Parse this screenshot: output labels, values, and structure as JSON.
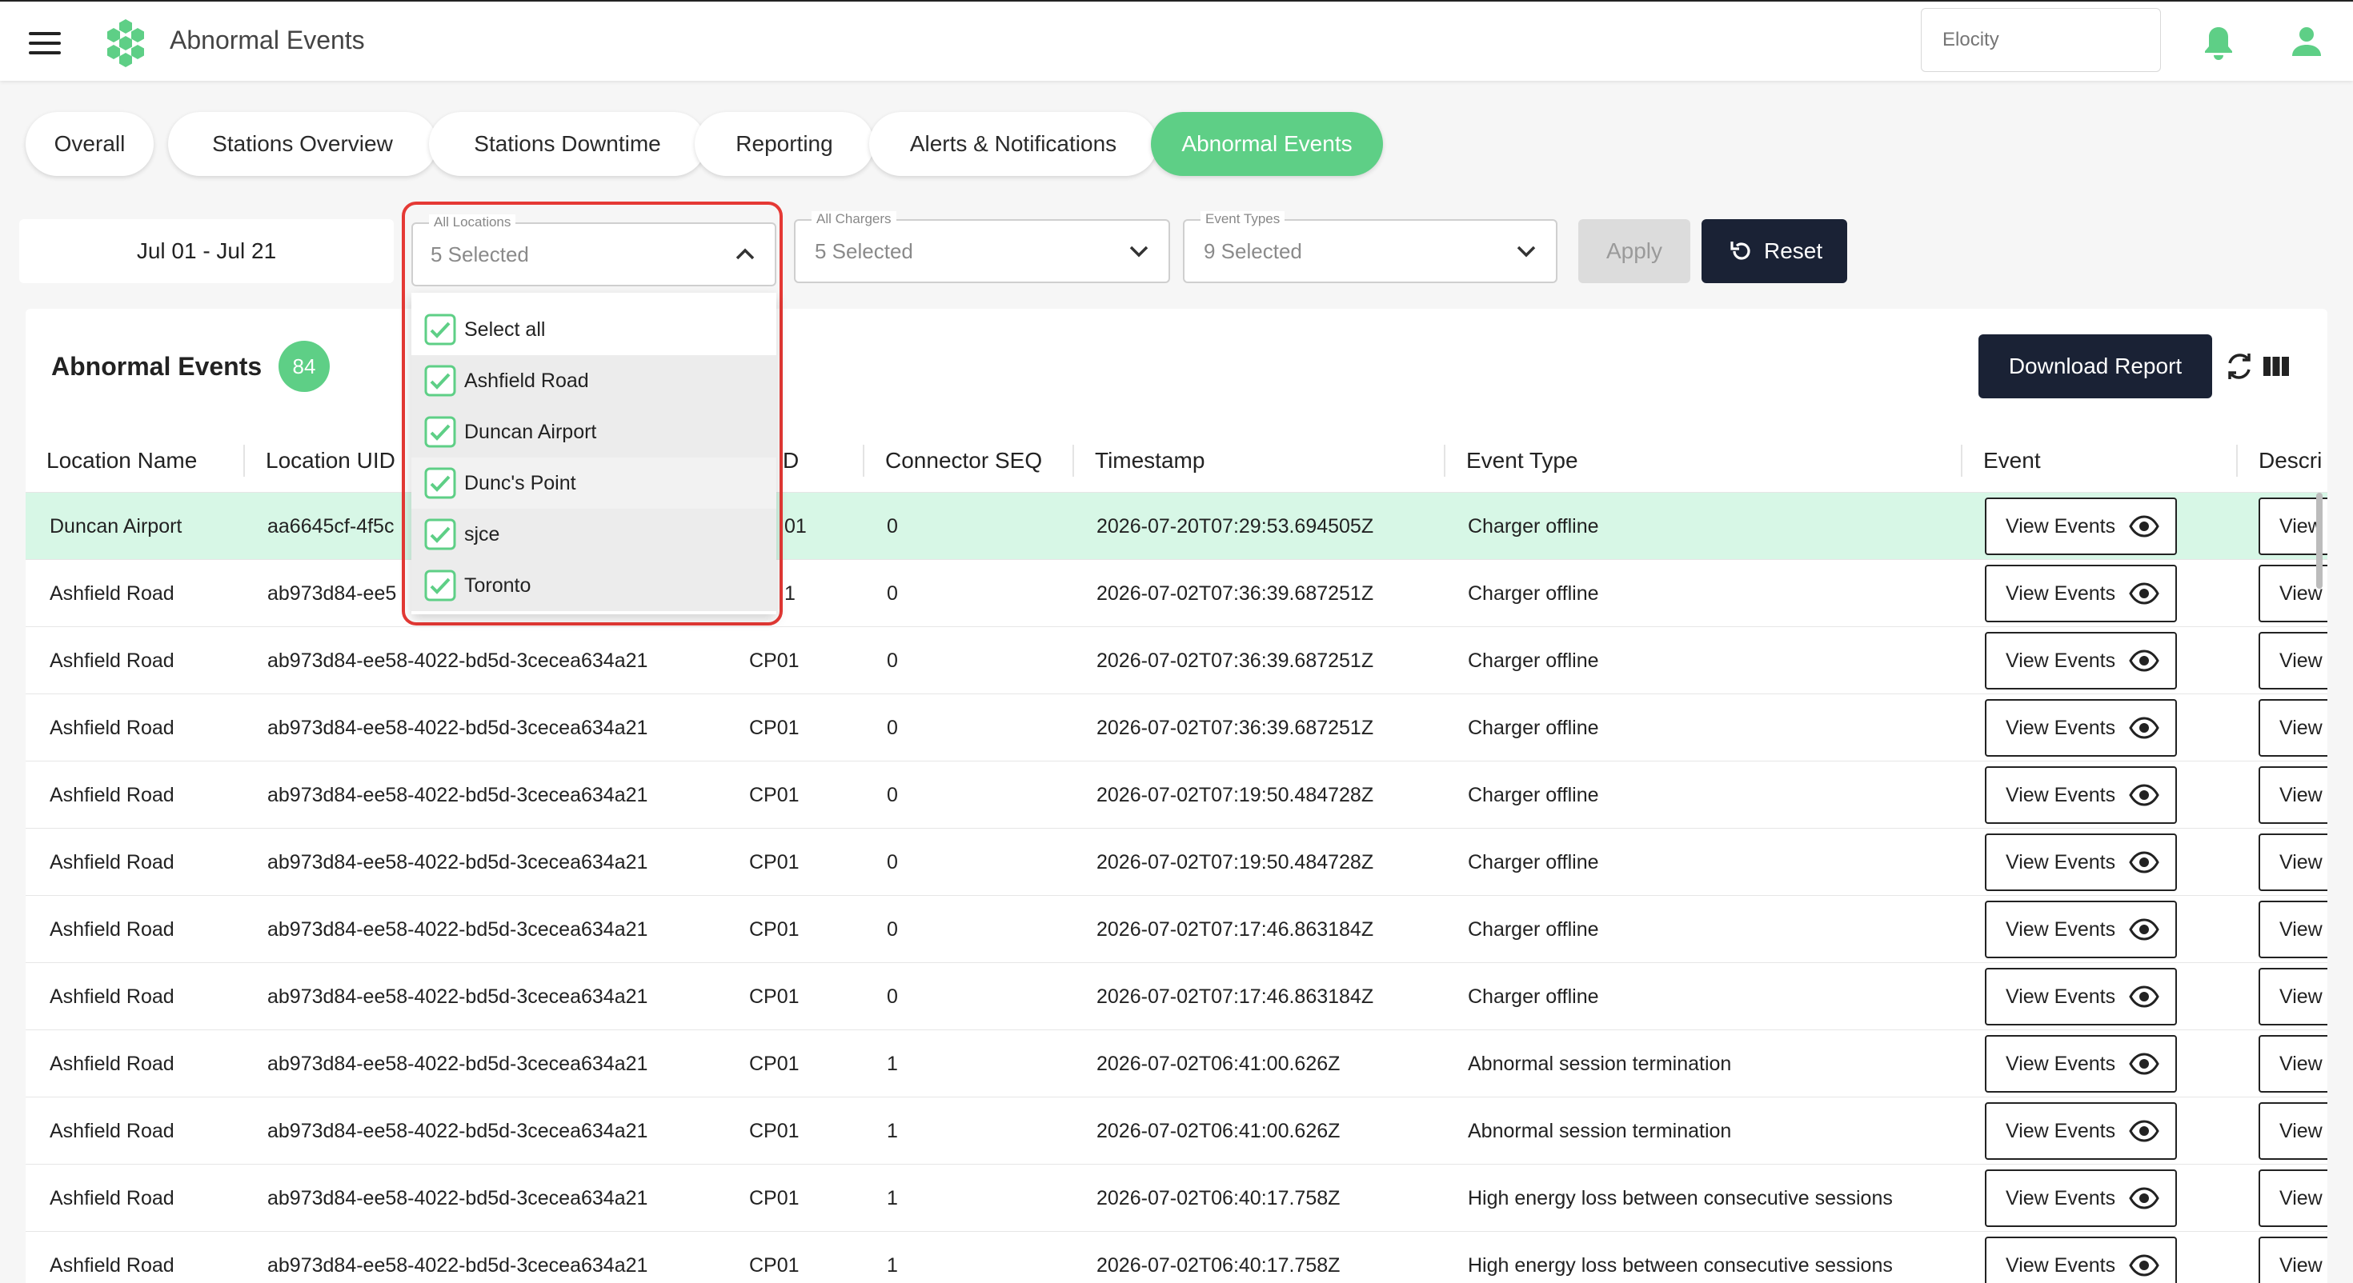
{
  "app": {
    "title": "Abnormal Events",
    "org_placeholder": "Elocity",
    "accent": "#5ecf86",
    "dark": "#1a2235"
  },
  "tabs": [
    {
      "label": "Overall",
      "active": false
    },
    {
      "label": "Stations Overview",
      "active": false
    },
    {
      "label": "Stations Downtime",
      "active": false
    },
    {
      "label": "Reporting",
      "active": false
    },
    {
      "label": "Alerts & Notifications",
      "active": false
    },
    {
      "label": "Abnormal Events",
      "active": true
    }
  ],
  "filters": {
    "date_range": "Jul 01 - Jul 21",
    "locations": {
      "label": "All Locations",
      "value": "5 Selected"
    },
    "chargers": {
      "label": "All Chargers",
      "value": "5 Selected"
    },
    "event_types": {
      "label": "Event Types",
      "value": "9 Selected"
    },
    "apply_label": "Apply",
    "reset_label": "Reset"
  },
  "location_dropdown": {
    "options": [
      {
        "label": "Select all",
        "checked": true
      },
      {
        "label": "Ashfield Road",
        "checked": true
      },
      {
        "label": "Duncan Airport",
        "checked": true
      },
      {
        "label": "Dunc's Point",
        "checked": true
      },
      {
        "label": "sjce",
        "checked": true
      },
      {
        "label": "Toronto",
        "checked": true
      }
    ]
  },
  "card": {
    "title": "Abnormal Events",
    "count": "84",
    "download_label": "Download Report"
  },
  "table": {
    "headers": [
      "Location Name",
      "Location UID",
      "D",
      "Connector SEQ",
      "Timestamp",
      "Event Type",
      "Event",
      "Descri"
    ],
    "view_label": "View Events",
    "view2_label": "View",
    "rows": [
      {
        "location": "Duncan Airport",
        "uid": "aa6645cf-4f5c",
        "charger": "01",
        "seq": "0",
        "ts": "2026-07-20T07:29:53.694505Z",
        "type": "Charger offline"
      },
      {
        "location": "Ashfield Road",
        "uid": "ab973d84-ee5",
        "charger": "1",
        "seq": "0",
        "ts": "2026-07-02T07:36:39.687251Z",
        "type": "Charger offline"
      },
      {
        "location": "Ashfield Road",
        "uid": "ab973d84-ee58-4022-bd5d-3cecea634a21",
        "charger": "CP01",
        "seq": "0",
        "ts": "2026-07-02T07:36:39.687251Z",
        "type": "Charger offline"
      },
      {
        "location": "Ashfield Road",
        "uid": "ab973d84-ee58-4022-bd5d-3cecea634a21",
        "charger": "CP01",
        "seq": "0",
        "ts": "2026-07-02T07:36:39.687251Z",
        "type": "Charger offline"
      },
      {
        "location": "Ashfield Road",
        "uid": "ab973d84-ee58-4022-bd5d-3cecea634a21",
        "charger": "CP01",
        "seq": "0",
        "ts": "2026-07-02T07:19:50.484728Z",
        "type": "Charger offline"
      },
      {
        "location": "Ashfield Road",
        "uid": "ab973d84-ee58-4022-bd5d-3cecea634a21",
        "charger": "CP01",
        "seq": "0",
        "ts": "2026-07-02T07:19:50.484728Z",
        "type": "Charger offline"
      },
      {
        "location": "Ashfield Road",
        "uid": "ab973d84-ee58-4022-bd5d-3cecea634a21",
        "charger": "CP01",
        "seq": "0",
        "ts": "2026-07-02T07:17:46.863184Z",
        "type": "Charger offline"
      },
      {
        "location": "Ashfield Road",
        "uid": "ab973d84-ee58-4022-bd5d-3cecea634a21",
        "charger": "CP01",
        "seq": "0",
        "ts": "2026-07-02T07:17:46.863184Z",
        "type": "Charger offline"
      },
      {
        "location": "Ashfield Road",
        "uid": "ab973d84-ee58-4022-bd5d-3cecea634a21",
        "charger": "CP01",
        "seq": "1",
        "ts": "2026-07-02T06:41:00.626Z",
        "type": "Abnormal session termination"
      },
      {
        "location": "Ashfield Road",
        "uid": "ab973d84-ee58-4022-bd5d-3cecea634a21",
        "charger": "CP01",
        "seq": "1",
        "ts": "2026-07-02T06:41:00.626Z",
        "type": "Abnormal session termination"
      },
      {
        "location": "Ashfield Road",
        "uid": "ab973d84-ee58-4022-bd5d-3cecea634a21",
        "charger": "CP01",
        "seq": "1",
        "ts": "2026-07-02T06:40:17.758Z",
        "type": "High energy loss between consecutive sessions"
      },
      {
        "location": "Ashfield Road",
        "uid": "ab973d84-ee58-4022-bd5d-3cecea634a21",
        "charger": "CP01",
        "seq": "1",
        "ts": "2026-07-02T06:40:17.758Z",
        "type": "High energy loss between consecutive sessions"
      }
    ]
  }
}
